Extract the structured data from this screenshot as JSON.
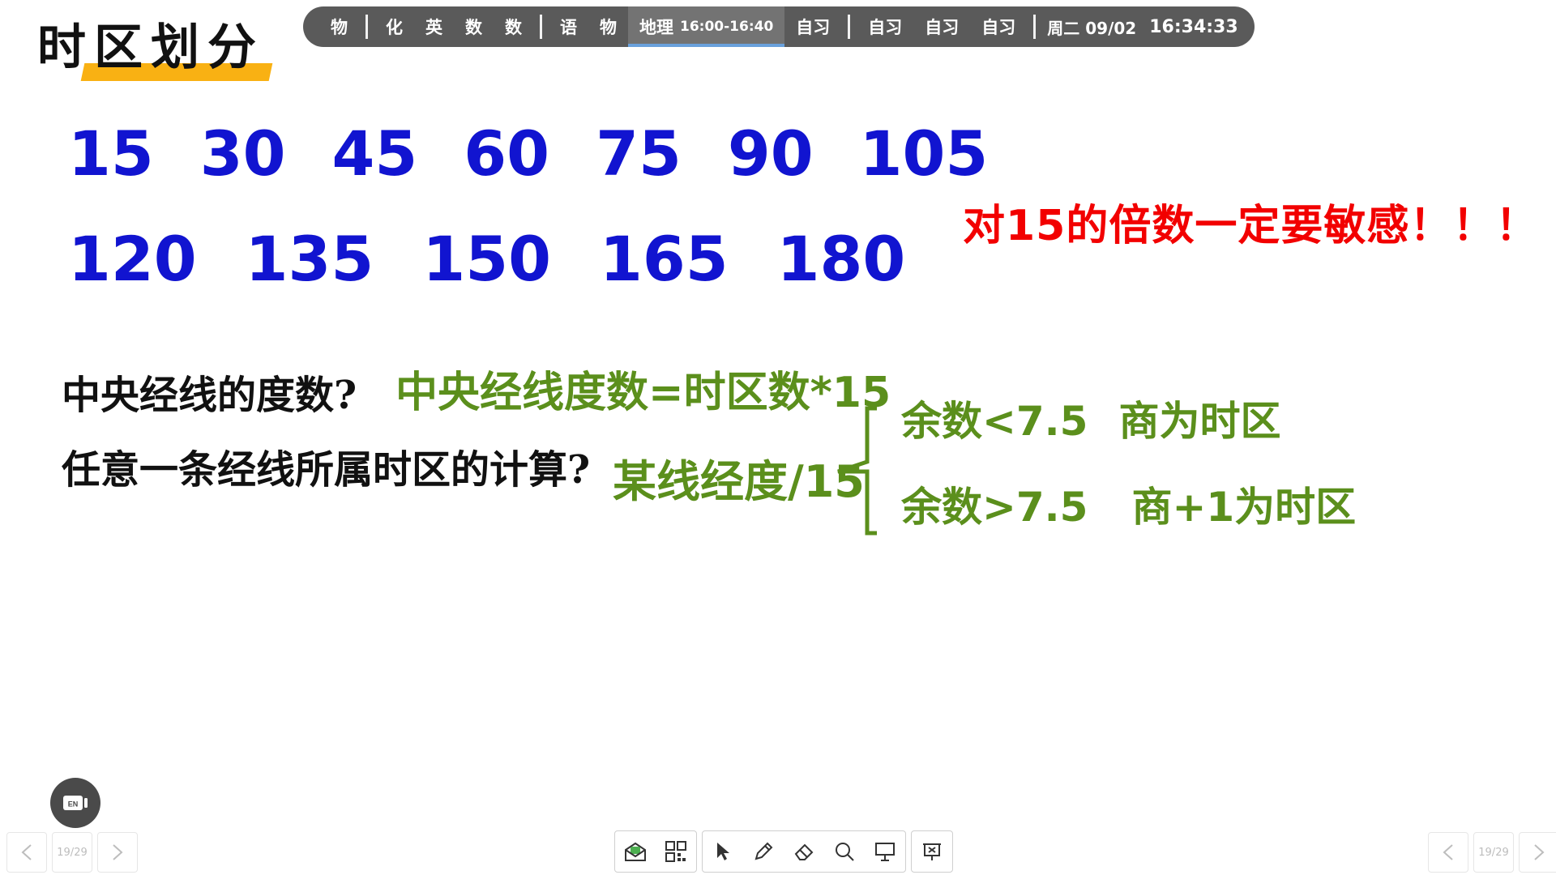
{
  "title": "时区划分",
  "schedule": {
    "subjects_a": [
      "物"
    ],
    "subjects_b": [
      "化",
      "英",
      "数",
      "数"
    ],
    "subjects_c": [
      "语",
      "物"
    ],
    "active_subject": "地理",
    "active_time": "16:00-16:40",
    "subjects_d": [
      "自习"
    ],
    "subjects_e": [
      "自习",
      "自习",
      "自习"
    ],
    "date": "周二 09/02",
    "clock": "16:34:33",
    "active_indicator_color": "#6aa1dc"
  },
  "numbers_row1": [
    "15",
    "30",
    "45",
    "60",
    "75",
    "90",
    "105"
  ],
  "numbers_row2": [
    "120",
    "135",
    "150",
    "165",
    "180"
  ],
  "emphasis": "对15的倍数一定要敏感！！！",
  "question1": "中央经线的度数?",
  "answer1": "中央经线度数=时区数*15",
  "question2": "任意一条经线所属时区的计算?",
  "answer2": "某线经度/15",
  "case1": {
    "condition": "余数<7.5",
    "result": "商为时区"
  },
  "case2": {
    "condition": "余数>7.5",
    "result": "商+1为时区"
  },
  "lang_button": "EN",
  "page_indicator": "19/29",
  "colors": {
    "number_blue": "#1114d0",
    "emphasis_red": "#f20000",
    "answer_green": "#5b8f1c",
    "title_highlight": "#f9b113",
    "schedule_bg": "#5a5a5a"
  },
  "toolbar_icons": [
    "message-icon",
    "qr-grid-icon",
    "cursor-icon",
    "pen-icon",
    "eraser-icon",
    "magnifier-icon",
    "display-icon",
    "slide-control-icon"
  ]
}
